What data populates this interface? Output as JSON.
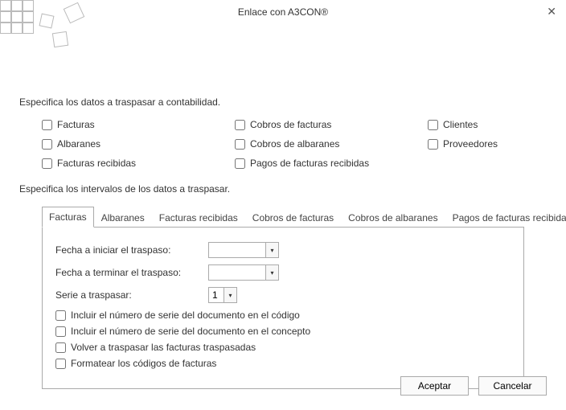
{
  "window": {
    "title": "Enlace con A3CON®"
  },
  "section1": {
    "label": "Especifica los datos a traspasar a contabilidad."
  },
  "checks": {
    "facturas": "Facturas",
    "albaranes": "Albaranes",
    "facturas_recibidas": "Facturas recibidas",
    "cobros_facturas": "Cobros de facturas",
    "cobros_albaranes": "Cobros de albaranes",
    "pagos_facturas_recibidas": "Pagos de facturas recibidas",
    "clientes": "Clientes",
    "proveedores": "Proveedores"
  },
  "section2": {
    "label": "Especifica los intervalos de los datos a traspasar."
  },
  "tabs": {
    "t0": "Facturas",
    "t1": "Albaranes",
    "t2": "Facturas recibidas",
    "t3": "Cobros de facturas",
    "t4": "Cobros de albaranes",
    "t5": "Pagos de facturas recibidas"
  },
  "panel": {
    "fecha_inicio_label": "Fecha a iniciar el traspaso:",
    "fecha_fin_label": "Fecha a terminar el traspaso:",
    "serie_label": "Serie a traspasar:",
    "fecha_inicio_value": "",
    "fecha_fin_value": "",
    "serie_value": "1",
    "opt_incluir_codigo": "Incluir el número de serie del documento en el código",
    "opt_incluir_concepto": "Incluir el número de serie del documento en el concepto",
    "opt_volver": "Volver a traspasar las facturas traspasadas",
    "opt_formatear": "Formatear los códigos de facturas"
  },
  "buttons": {
    "accept": "Aceptar",
    "cancel": "Cancelar"
  },
  "glyphs": {
    "close": "✕",
    "left": "◂",
    "right": "▸",
    "down": "▾"
  }
}
